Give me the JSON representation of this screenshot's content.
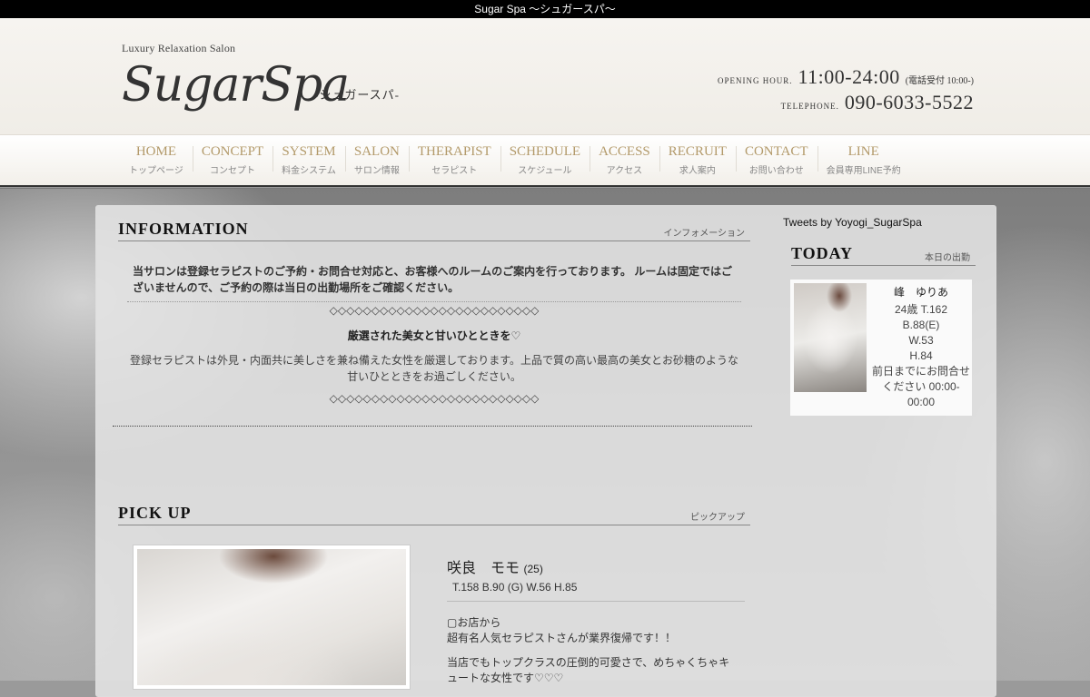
{
  "topbar": {
    "title": "Sugar Spa 〜シュガースパ〜"
  },
  "header": {
    "logo_sub": "Luxury Relaxation Salon",
    "logo_main": "SugarSpa",
    "logo_kana": "-シュガースパ-",
    "opening_label": "OPENING HOUR.",
    "opening_hours": "11:00-24:00",
    "opening_note": "(電話受付 10:00-)",
    "phone_label": "TELEPHONE.",
    "phone": "090-6033-5522"
  },
  "nav": [
    {
      "en": "HOME",
      "jp": "トップページ"
    },
    {
      "en": "CONCEPT",
      "jp": "コンセプト"
    },
    {
      "en": "SYSTEM",
      "jp": "料金システム"
    },
    {
      "en": "SALON",
      "jp": "サロン情報"
    },
    {
      "en": "THERAPIST",
      "jp": "セラピスト"
    },
    {
      "en": "SCHEDULE",
      "jp": "スケジュール"
    },
    {
      "en": "ACCESS",
      "jp": "アクセス"
    },
    {
      "en": "RECRUIT",
      "jp": "求人案内"
    },
    {
      "en": "CONTACT",
      "jp": "お問い合わせ"
    },
    {
      "en": "LINE",
      "jp": "会員専用LINE予約"
    }
  ],
  "information": {
    "title": "INFORMATION",
    "subtitle": "インフォメーション",
    "lead": "当サロンは登録セラピストのご予約・お問合せ対応と、お客様へのルームのご案内を行っております。 ルームは固定ではございませんので、ご予約の際は当日の出勤場所をご確認ください。",
    "diamonds1": "◇◇◇◇◇◇◇◇◇◇◇◇◇◇◇◇◇◇◇◇◇◇◇◇◇",
    "strong": "厳選された美女と甘いひとときを♡",
    "text": "登録セラピストは外見・内面共に美しさを兼ね備えた女性を厳選しております。上品で質の高い最高の美女とお砂糖のような甘いひとときをお過ごしください。",
    "diamonds2": "◇◇◇◇◇◇◇◇◇◇◇◇◇◇◇◇◇◇◇◇◇◇◇◇◇"
  },
  "pickup": {
    "title": "PICK UP",
    "subtitle": "ピックアップ",
    "name": "咲良　モモ",
    "age": "(25)",
    "size": "T.158 B.90 (G) W.56 H.85",
    "desc1": "▢お店から",
    "desc2": "超有名人気セラピストさんが業界復帰です！！",
    "desc3": "当店でもトップクラスの圧倒的可愛さで、めちゃくちゃキュートな女性です♡♡♡"
  },
  "sidebar": {
    "tweets": "Tweets by Yoyogi_SugarSpa",
    "today_title": "TODAY",
    "today_sub": "本日の出勤",
    "therapist_name": "峰　ゆりあ",
    "therapist_lines": [
      "24歳 T.162",
      "B.88(E)",
      "W.53",
      "H.84"
    ],
    "therapist_note": "前日までにお問合せください 00:00-00:00"
  }
}
